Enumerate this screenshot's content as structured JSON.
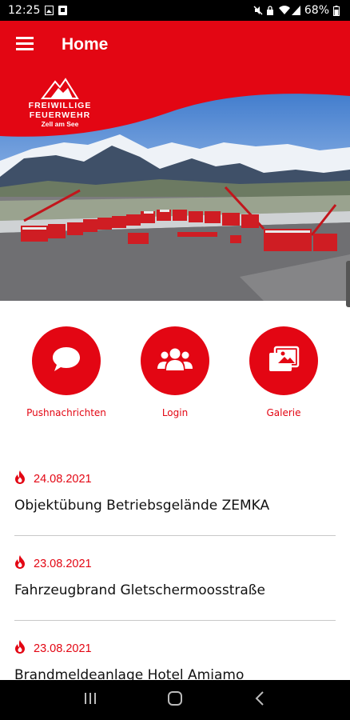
{
  "status_bar": {
    "time": "12:25",
    "battery": "68%"
  },
  "app_bar": {
    "title": "Home"
  },
  "hero": {
    "logo_line1": "FREIWILLIGE",
    "logo_line2": "FEUERWEHR",
    "logo_line3": "Zell am See"
  },
  "actions": [
    {
      "label": "Pushnachrichten",
      "icon": "chat-bubble-icon"
    },
    {
      "label": "Login",
      "icon": "users-group-icon"
    },
    {
      "label": "Galerie",
      "icon": "gallery-icon"
    }
  ],
  "news": [
    {
      "date": "24.08.2021",
      "title": "Objektübung Betriebsgelände ZEMKA"
    },
    {
      "date": "23.08.2021",
      "title": "Fahrzeugbrand Gletschermoosstraße"
    },
    {
      "date": "23.08.2021",
      "title": "Brandmeldeanlage Hotel Amiamo"
    }
  ],
  "colors": {
    "accent": "#e30613",
    "text": "#111111",
    "divider": "#c8c8c8"
  }
}
